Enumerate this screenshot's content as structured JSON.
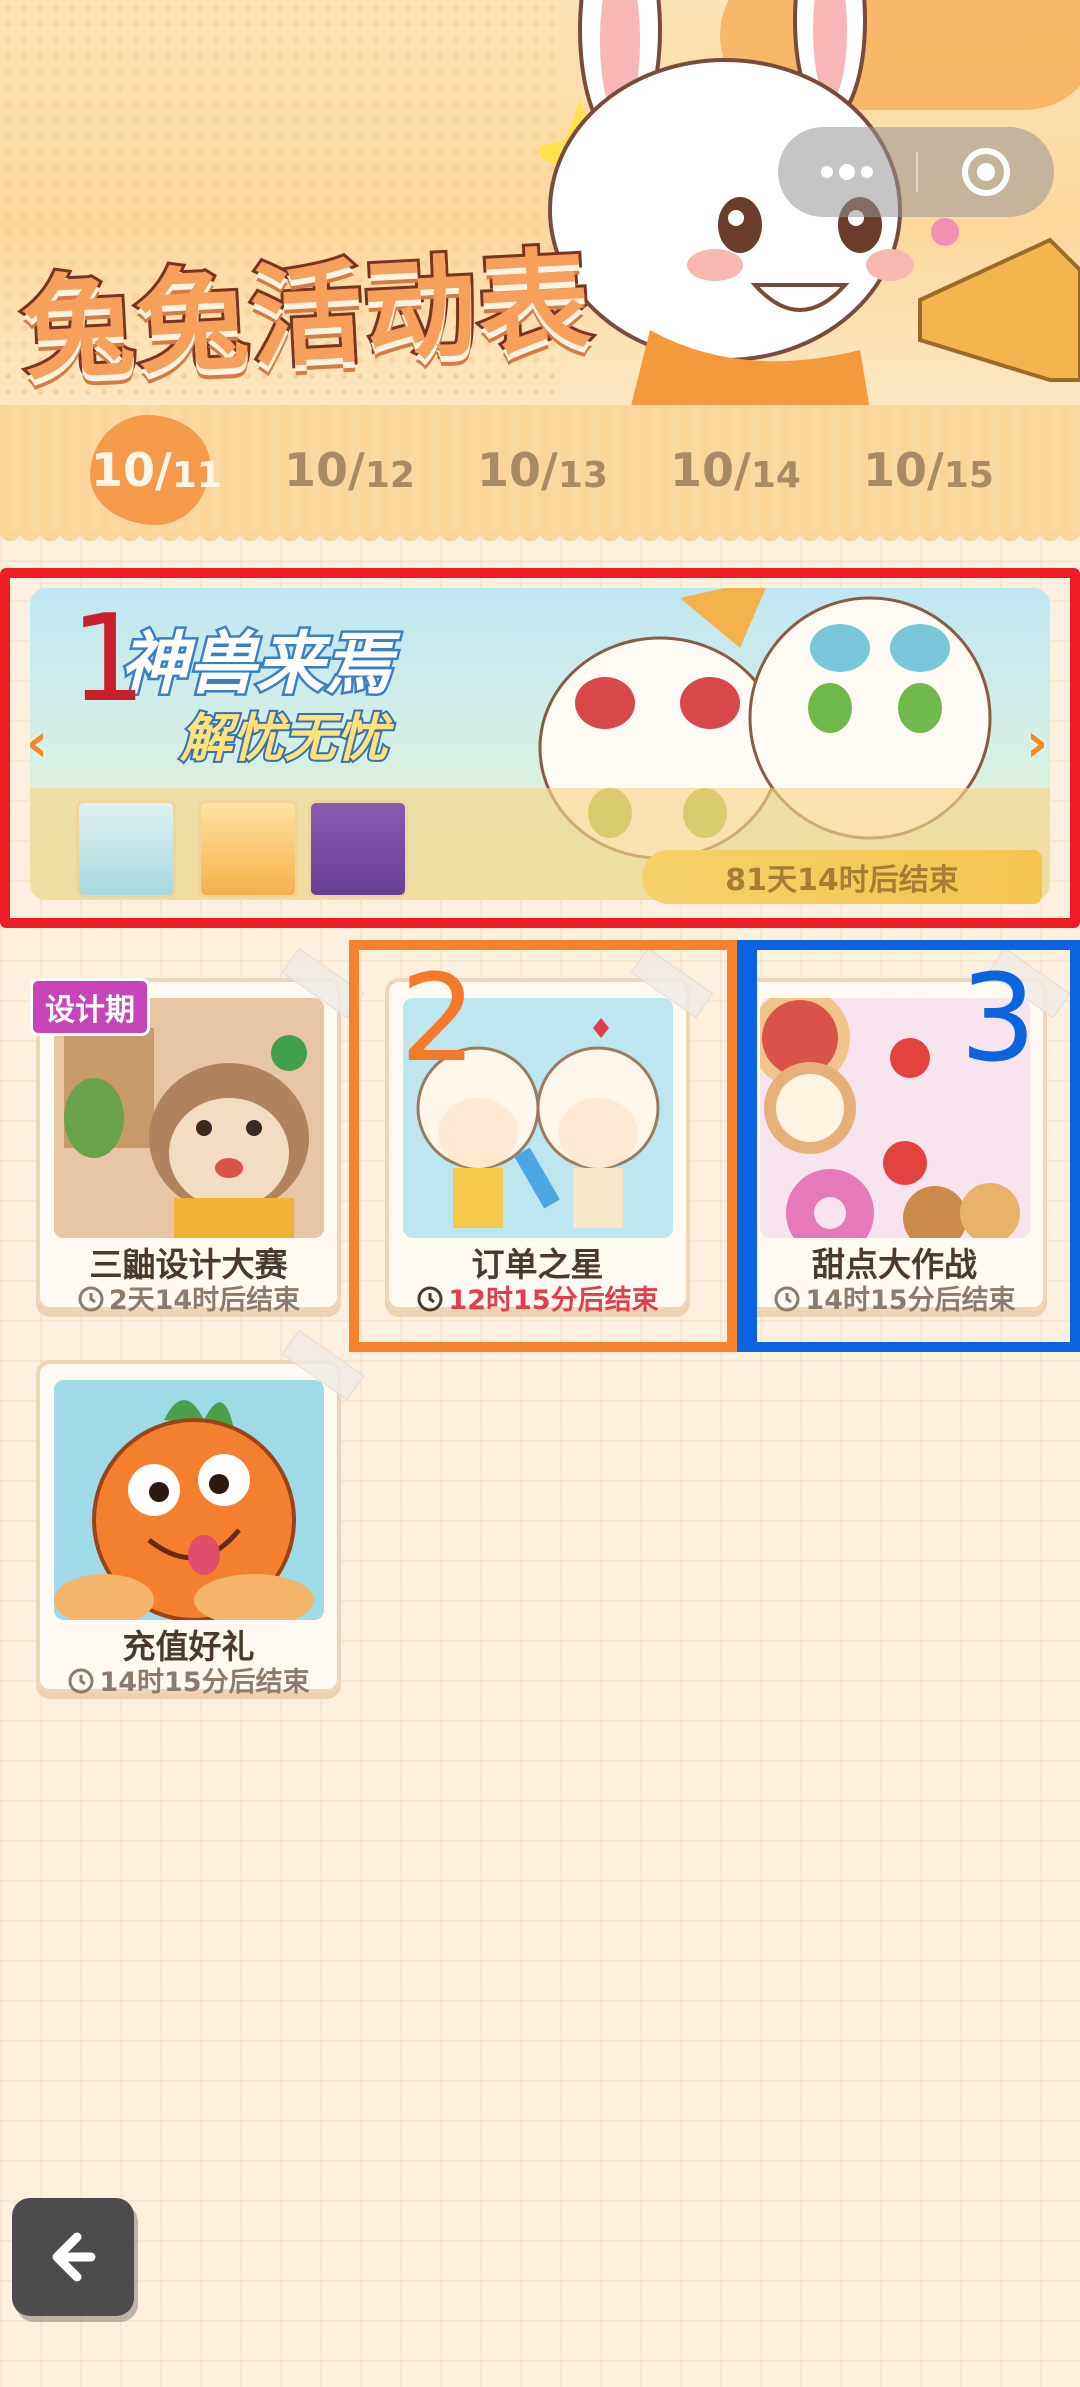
{
  "header": {
    "title": "兔兔活动表",
    "menu_icon": "more-dots-icon",
    "close_icon": "target-circle-icon"
  },
  "dates": [
    {
      "big": "10/",
      "small": "11",
      "active": true
    },
    {
      "big": "10/",
      "small": "12",
      "active": false
    },
    {
      "big": "10/",
      "small": "13",
      "active": false
    },
    {
      "big": "10/",
      "small": "14",
      "active": false
    },
    {
      "big": "10/",
      "small": "15",
      "active": false
    }
  ],
  "featured": {
    "title": "神兽来焉",
    "subtitle": "解忧无忧",
    "timer": "81天14时后结束",
    "prev_icon": "chevron-left-icon",
    "next_icon": "chevron-right-icon"
  },
  "annotations": {
    "box1": "1",
    "box2": "2",
    "box3": "3",
    "colors": {
      "box1": "#ee1c25",
      "box2": "#f7822d",
      "box3": "#0a64e0"
    }
  },
  "cards": [
    {
      "name": "三鼬设计大赛",
      "time": "2天14时后结束",
      "badge": "设计期",
      "time_red": false
    },
    {
      "name": "订单之星",
      "time": "12时15分后结束",
      "time_red": true
    },
    {
      "name": "甜点大作战",
      "time": "14时15分后结束",
      "time_red": false
    },
    {
      "name": "充值好礼",
      "time": "14时15分后结束",
      "time_red": false
    }
  ],
  "back_icon": "back-arrow-icon"
}
